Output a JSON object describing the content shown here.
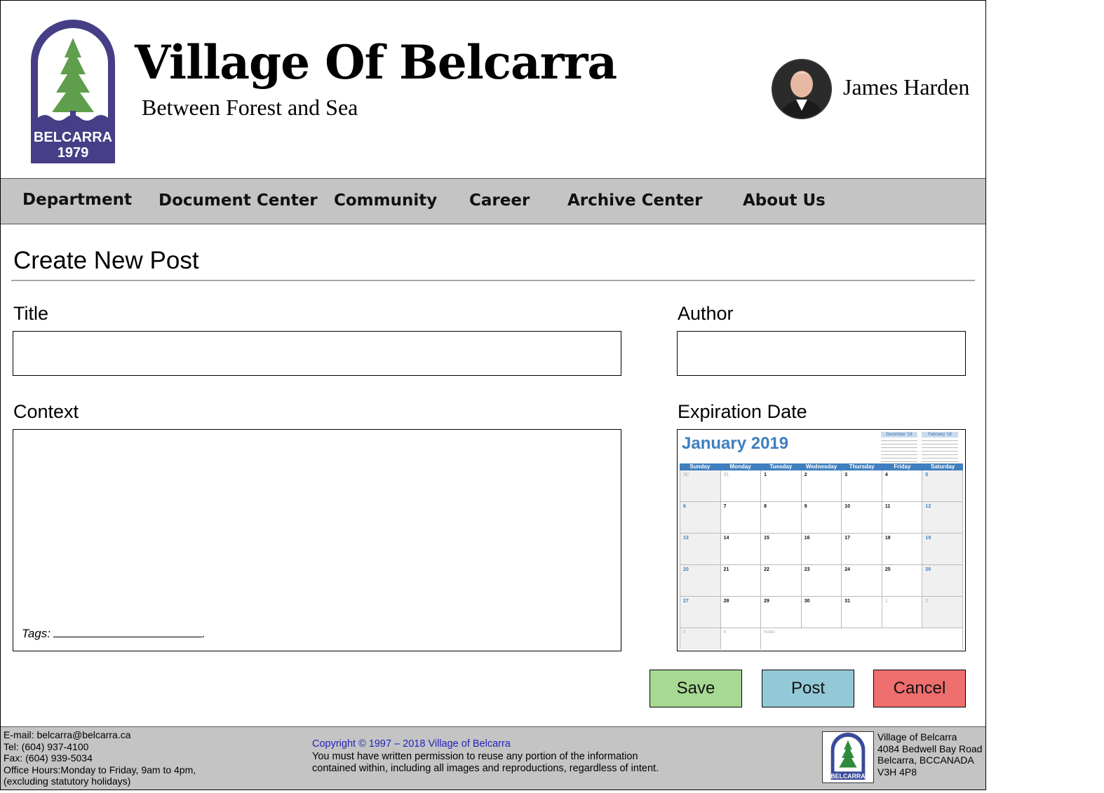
{
  "header": {
    "logo_text": "BELCARRA",
    "logo_year": "1979",
    "site_title": "Village Of Belcarra",
    "tagline": "Between Forest and Sea",
    "user_name": "James Harden"
  },
  "nav": {
    "items": [
      "Department",
      "Document Center",
      "Community",
      "Career",
      "Archive Center",
      "About Us"
    ]
  },
  "form": {
    "page_title": "Create New Post",
    "title_label": "Title",
    "title_value": "",
    "author_label": "Author",
    "author_value": "",
    "context_label": "Context",
    "tags_label": "Tags:",
    "tags_end": ".",
    "expiration_label": "Expiration Date"
  },
  "calendar": {
    "month": "January 2019",
    "prev_month": "December '18",
    "next_month": "February '19",
    "weekdays": [
      "Sunday",
      "Monday",
      "Tuesday",
      "Wednesday",
      "Thursday",
      "Friday",
      "Saturday"
    ],
    "weeks": [
      [
        "30",
        "31",
        "1",
        "2",
        "3",
        "4",
        "5"
      ],
      [
        "6",
        "7",
        "8",
        "9",
        "10",
        "11",
        "12"
      ],
      [
        "13",
        "14",
        "15",
        "16",
        "17",
        "18",
        "19"
      ],
      [
        "20",
        "21",
        "22",
        "23",
        "24",
        "25",
        "26"
      ],
      [
        "27",
        "28",
        "29",
        "30",
        "31",
        "1",
        "2"
      ]
    ],
    "last_row": [
      "3",
      "4"
    ],
    "notes_label": "Notes",
    "accent_color": "#3f7fbf"
  },
  "buttons": {
    "save": "Save",
    "post": "Post",
    "cancel": "Cancel",
    "save_color": "#a8d992",
    "post_color": "#93c8d6",
    "cancel_color": "#ef6e6e"
  },
  "footer": {
    "email": "E-mail: belcarra@belcarra.ca",
    "tel": "Tel: (604) 937-4100",
    "fax": "Fax: (604) 939-5034",
    "hours": "Office Hours:Monday to Friday, 9am to 4pm,",
    "hours_note": "(excluding statutory holidays)",
    "copyright": "Copyright © 1997 – 2018 Village of Belcarra",
    "notice_line1": "You must have written permission to reuse any portion of the information",
    "notice_line2": "contained within, including all images and reproductions, regardless of intent.",
    "address_name": "Village of Belcarra",
    "address_street": "4084 Bedwell Bay Road",
    "address_city": "Belcarra, BCCANADA",
    "address_postal": "V3H 4P8",
    "logo_text": "BELCARRA"
  }
}
